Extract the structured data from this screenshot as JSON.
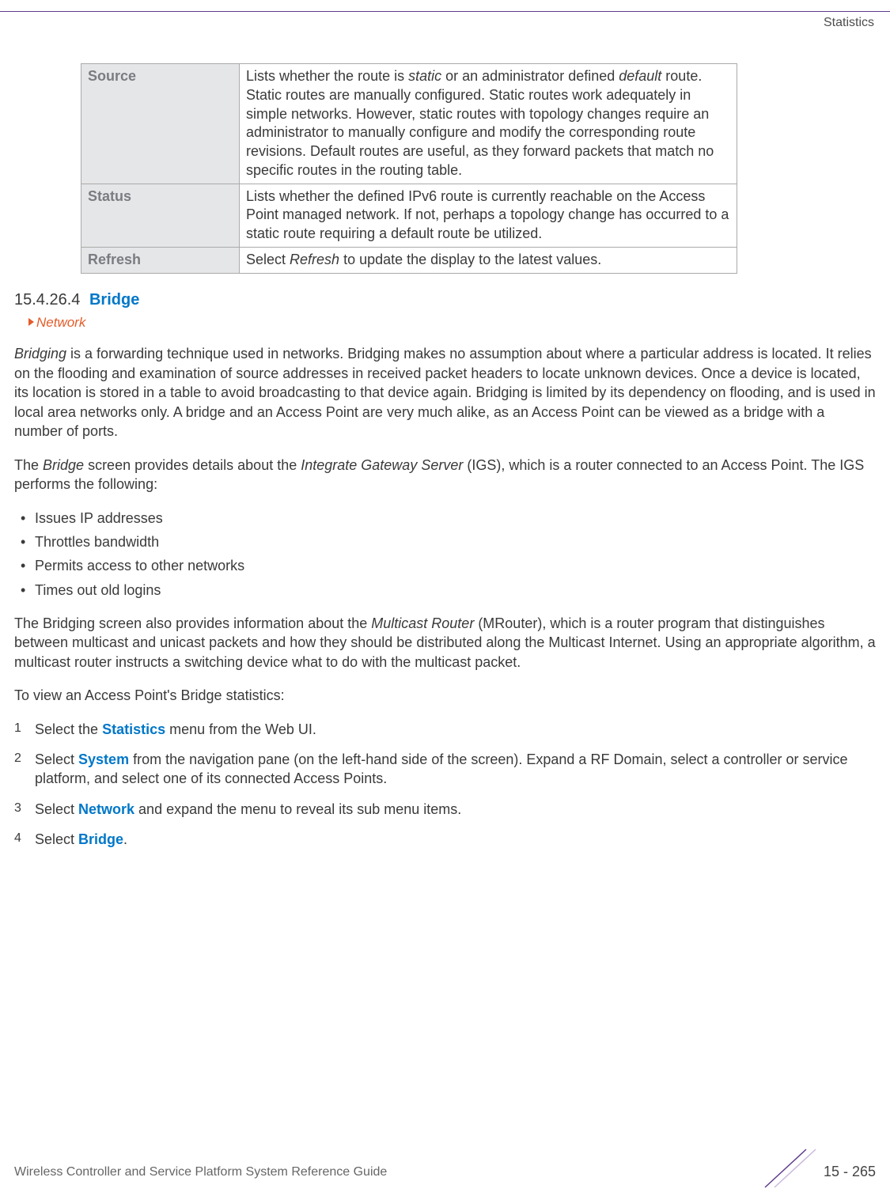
{
  "header": {
    "right": "Statistics"
  },
  "table": {
    "rows": [
      {
        "term": "Source",
        "desc_parts": [
          "Lists whether the route is ",
          "static",
          " or an administrator defined ",
          "default",
          " route. Static routes are manually configured. Static routes work adequately in simple networks. However, static routes with topology changes require an administrator to manually configure and modify the corresponding route revisions. Default routes are useful, as they forward packets that match no specific routes in the routing table."
        ]
      },
      {
        "term": "Status",
        "desc_parts": [
          "Lists whether the defined IPv6 route is currently reachable on the Access Point managed network. If not, perhaps a topology change has occurred to a static route requiring a default route be utilized."
        ]
      },
      {
        "term": "Refresh",
        "desc_parts": [
          "Select ",
          "Refresh",
          " to update the display to the latest values."
        ]
      }
    ]
  },
  "section": {
    "number": "15.4.26.4",
    "title": "Bridge",
    "subnav": "Network"
  },
  "paragraphs": {
    "p1_parts": [
      "Bridging",
      " is a forwarding technique used in networks. Bridging makes no assumption about where a particular address is located. It relies on the flooding and examination of source addresses in received packet headers to locate unknown devices. Once a device is located, its location is stored in a table to avoid broadcasting to that device again. Bridging is limited by its dependency on flooding, and is used in local area networks only. A bridge and an Access Point are very much alike, as an Access Point can be viewed as a bridge with a number of ports."
    ],
    "p2_parts": [
      "The ",
      "Bridge",
      " screen provides details about the ",
      "Integrate Gateway Server",
      " (IGS), which is a router connected to an Access Point. The IGS performs the following:"
    ],
    "p3_parts": [
      "The Bridging screen also provides information about the ",
      "Multicast Router",
      " (MRouter), which is a router program that distinguishes between multicast and unicast packets and how they should be distributed along the Multicast Internet. Using an appropriate algorithm, a multicast router instructs a switching device what to do with the multicast packet."
    ],
    "p4": "To view an Access Point's Bridge statistics:"
  },
  "bullets": [
    "Issues IP addresses",
    "Throttles bandwidth",
    "Permits access to other networks",
    "Times out old logins"
  ],
  "steps": [
    {
      "n": "1",
      "parts": [
        "Select the ",
        "Statistics",
        " menu from the Web UI."
      ]
    },
    {
      "n": "2",
      "parts": [
        "Select ",
        "System",
        " from the navigation pane (on the left-hand side of the screen). Expand a RF Domain, select a controller or service platform, and select one of its connected Access Points."
      ]
    },
    {
      "n": "3",
      "parts": [
        "Select ",
        "Network",
        " and expand the menu to reveal its sub menu items."
      ]
    },
    {
      "n": "4",
      "parts": [
        "Select ",
        "Bridge",
        "."
      ]
    }
  ],
  "footer": {
    "left": "Wireless Controller and Service Platform System Reference Guide",
    "right": "15 - 265"
  }
}
